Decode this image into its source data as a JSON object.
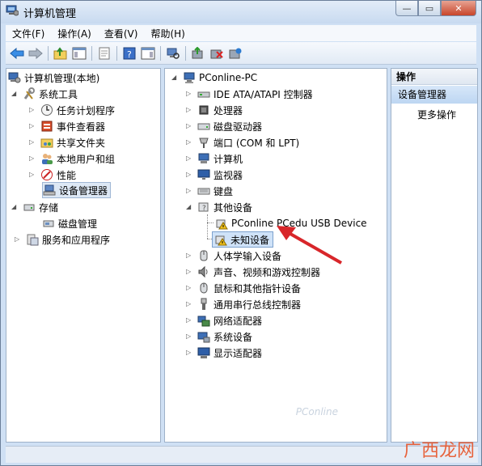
{
  "window": {
    "title": "计算机管理",
    "controls": [
      "minimize",
      "maximize",
      "close"
    ]
  },
  "menu": [
    "文件(F)",
    "操作(A)",
    "查看(V)",
    "帮助(H)"
  ],
  "toolbar_icons": [
    "back-arrow-icon",
    "forward-arrow-icon",
    "up-folder-icon",
    "show-hide-tree-icon",
    "export-list-icon",
    "help-icon",
    "action-pane-icon",
    "scan-hardware-icon",
    "update-driver-icon",
    "disable-device-icon",
    "uninstall-device-icon"
  ],
  "left_tree": {
    "root": "计算机管理(本地)",
    "system_tools": "系统工具",
    "system_children": [
      "任务计划程序",
      "事件查看器",
      "共享文件夹",
      "本地用户和组",
      "性能",
      "设备管理器"
    ],
    "storage": "存储",
    "disk_mgmt": "磁盘管理",
    "services": "服务和应用程序"
  },
  "device_tree": {
    "root": "PConline-PC",
    "categories_top": [
      "IDE ATA/ATAPI 控制器",
      "处理器",
      "磁盘驱动器",
      "端口 (COM 和 LPT)",
      "计算机",
      "监视器",
      "键盘"
    ],
    "other_devices": "其他设备",
    "other_children": [
      "PConline PCedu USB Device",
      "未知设备"
    ],
    "categories_bottom": [
      "人体学输入设备",
      "声音、视频和游戏控制器",
      "鼠标和其他指针设备",
      "通用串行总线控制器",
      "网络适配器",
      "系统设备",
      "显示适配器"
    ]
  },
  "actions": {
    "header": "操作",
    "selected": "设备管理器",
    "more": "更多操作"
  },
  "watermark": "广西龙网",
  "colors": {
    "accent": "#3a7bd5",
    "arrow": "#d8262a",
    "warning": "#f2c21b"
  }
}
